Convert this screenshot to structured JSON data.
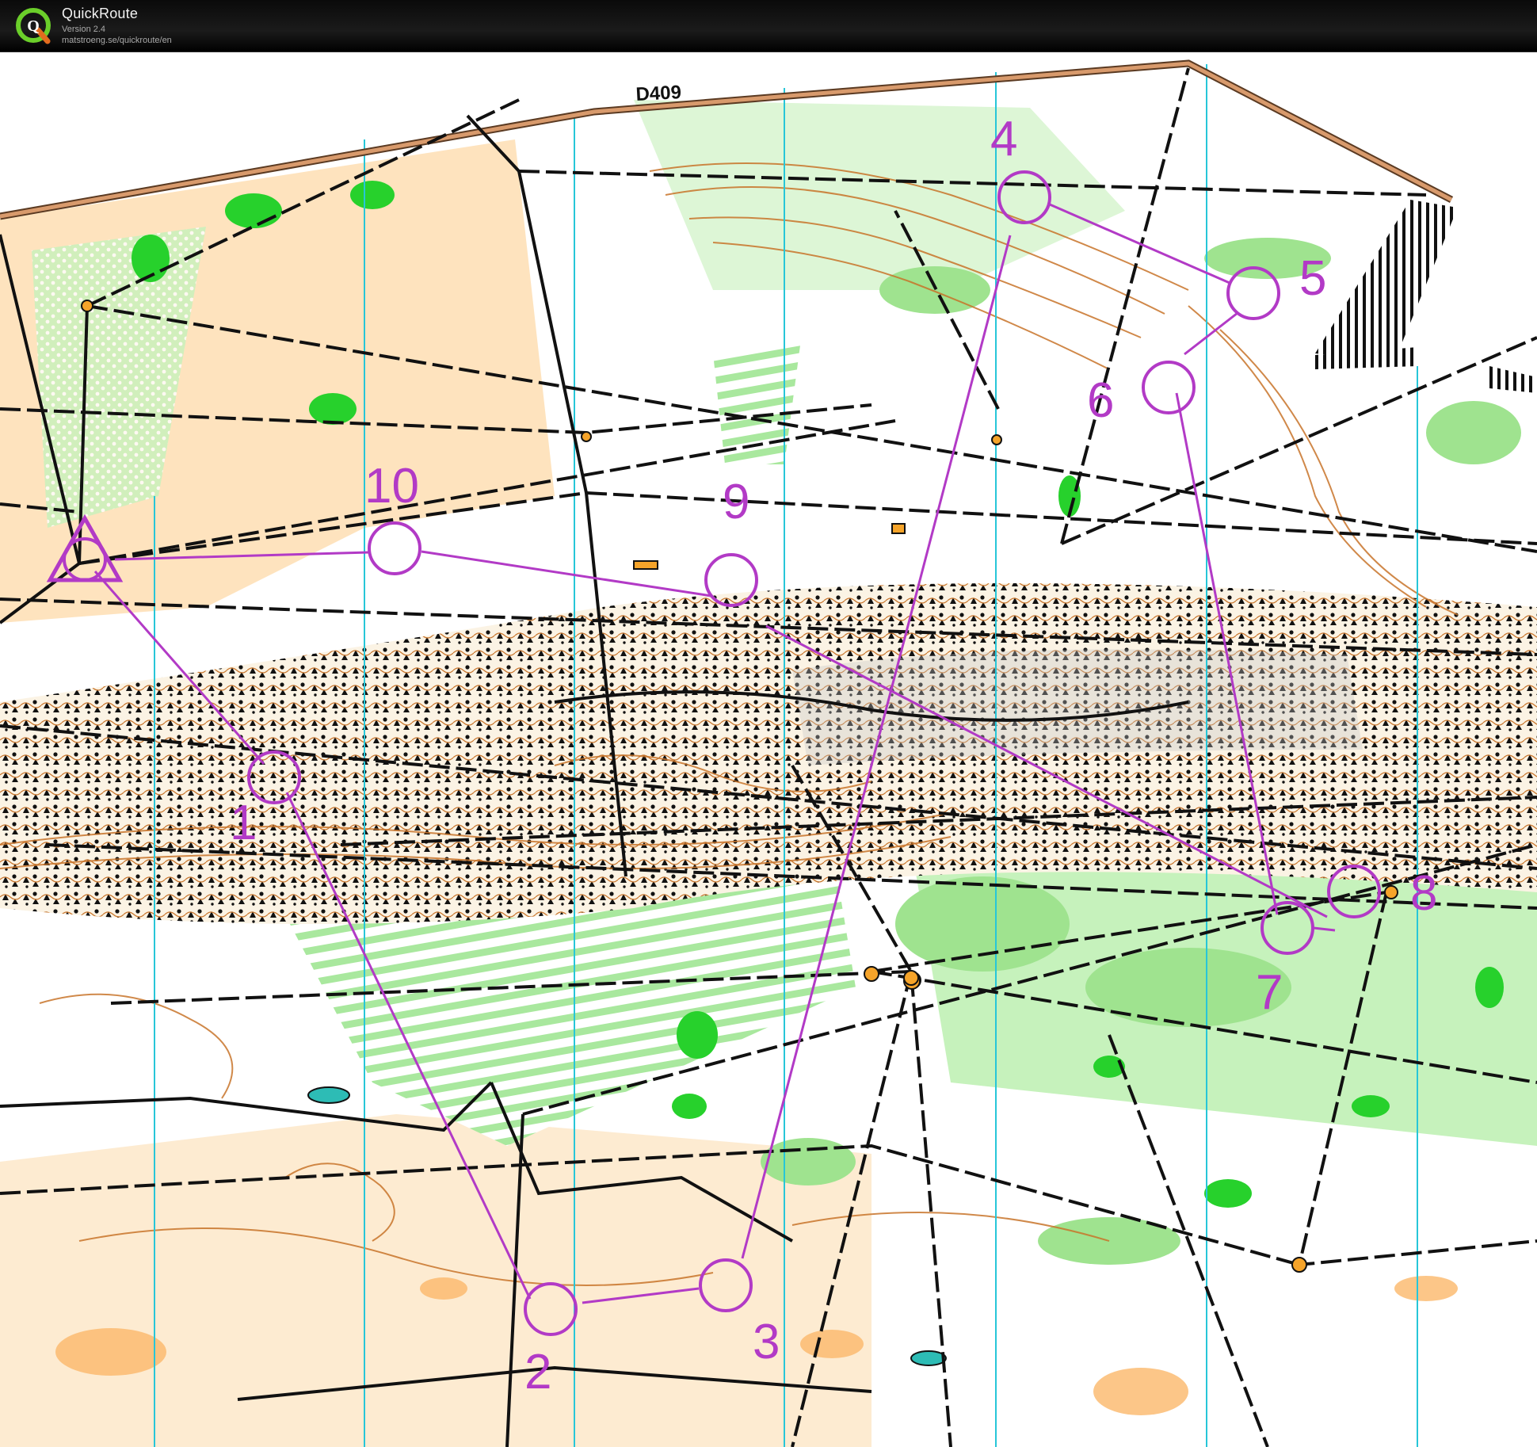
{
  "app": {
    "name": "QuickRoute",
    "version": "Version 2.4",
    "url": "matstroeng.se/quickroute/en",
    "logo_letter": "Q"
  },
  "map": {
    "road_label": "D409",
    "controls": [
      {
        "id": "start",
        "label": ""
      },
      {
        "id": "1",
        "label": "1"
      },
      {
        "id": "2",
        "label": "2"
      },
      {
        "id": "3",
        "label": "3"
      },
      {
        "id": "4",
        "label": "4"
      },
      {
        "id": "5",
        "label": "5"
      },
      {
        "id": "6",
        "label": "6"
      },
      {
        "id": "7",
        "label": "7"
      },
      {
        "id": "8",
        "label": "8"
      },
      {
        "id": "9",
        "label": "9"
      },
      {
        "id": "10",
        "label": "10"
      }
    ],
    "colors": {
      "course": "#b23ac6",
      "vegetation_light": "#c6f2bc",
      "vegetation_dense": "#27d12c",
      "open_land": "#fdd9a8",
      "contour": "#c8742a",
      "road": "#d89a6c",
      "north_line": "#27c6d8",
      "track": "#111111"
    }
  }
}
